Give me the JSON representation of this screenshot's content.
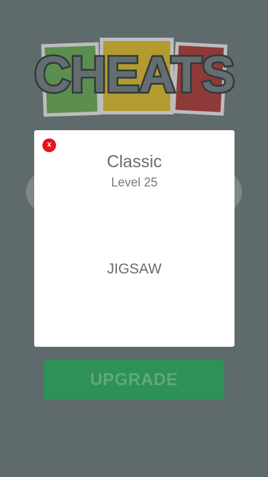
{
  "logo": {
    "text": "CHEATS"
  },
  "modal": {
    "close_label": "x",
    "mode_title": "Classic",
    "level_label": "Level 25",
    "answer": "JIGSAW"
  },
  "upgrade": {
    "label": "UPGRADE"
  },
  "colors": {
    "background": "#5f6a6c",
    "card_green": "#5b8e4f",
    "card_yellow": "#b39b2f",
    "card_red": "#8e3a38",
    "close_red": "#e8141b",
    "upgrade_green": "#2e9158"
  }
}
